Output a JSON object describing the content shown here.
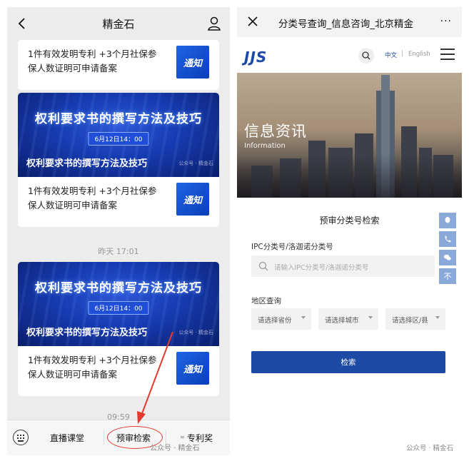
{
  "left": {
    "header": {
      "title": "精金石"
    },
    "items": [
      {
        "line1": "1件有效发明专利 +3个月社保参",
        "line2": "保人数证明可申请备案",
        "thumb": "通知"
      },
      {
        "line1": "1件有效发明专利 +3个月社保参",
        "line2": "保人数证明可申请备案",
        "thumb": "通知"
      },
      {
        "line1": "1件有效发明专利 +3个月社保参",
        "line2": "保人数证明可申请备案",
        "thumb": "通知"
      }
    ],
    "banners": [
      {
        "title": "权利要求书的撰写方法及技巧",
        "date": "6月12日14：00",
        "subtitle": "权利要求书的撰写方法及技巧",
        "wm": "公众号 · 精金石"
      },
      {
        "title": "权利要求书的撰写方法及技巧",
        "date": "6月12日14：00",
        "subtitle": "权利要求书的撰写方法及技巧",
        "wm": "公众号 · 精金石"
      }
    ],
    "times": {
      "yesterday": "昨天 17:01",
      "bottom_time": "09:59"
    },
    "bottom_menu": {
      "live": "直播课堂",
      "search": "预审检索",
      "award": "专利奖",
      "award_prefix": "≡",
      "wm": "公众号 · 精金石"
    }
  },
  "right": {
    "header": {
      "close": "×",
      "title": "分类号查询_信息咨询_北京精金",
      "more": "···"
    },
    "nav": {
      "logo": "JJS",
      "lang_zh": "中文",
      "lang_sep": "|",
      "lang_en": "English"
    },
    "hero": {
      "title": "信息资讯",
      "subtitle": "Information"
    },
    "form": {
      "title": "预审分类号检索",
      "ipc_label": "IPC分类号/洛迦诺分类号",
      "ipc_placeholder": "请输入IPC分类号/洛迦诺分类号",
      "region_label": "地区查询",
      "province": "请选择省份",
      "city": "请选择城市",
      "district": "请选择区/县",
      "submit": "检索"
    },
    "side_tools": [
      "qq-icon",
      "phone-icon",
      "wechat-icon",
      "top-icon"
    ],
    "side_top_label": "不",
    "wm": "公众号 · 精金石"
  },
  "colors": {
    "brand_blue": "#1c4aa4",
    "annotation_red": "#e23a2f",
    "tool_blue": "#8aa9d8"
  }
}
